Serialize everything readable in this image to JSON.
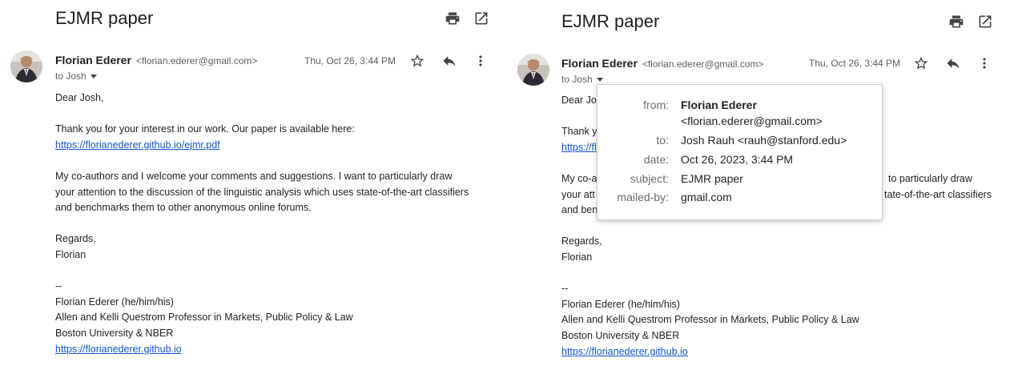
{
  "left_pane": {
    "subject": "EJMR paper",
    "sender_name": "Florian Ederer",
    "sender_email": "<florian.ederer@gmail.com>",
    "to_line": "to Josh",
    "date": "Thu, Oct 26, 3:44 PM",
    "icons": [
      "print-icon",
      "open-in-new-window-icon",
      "star-icon",
      "reply-icon",
      "more-vert-icon"
    ],
    "body": {
      "greeting": "Dear Josh,",
      "p1": "Thank you for your interest in our work. Our paper is available here:",
      "paper_link": "https://florianederer.github.io/ejmr.pdf",
      "p2_l1": "My co-authors and I welcome your comments and suggestions. I want to particularly draw",
      "p2_l2": "your attention to the discussion of the linguistic analysis which uses state-of-the-art classifiers",
      "p2_l3": "and benchmarks them to other anonymous online forums.",
      "closing": "Regards,",
      "closing_name": "Florian",
      "sig_sep": "--",
      "sig_name": "Florian Ederer (he/him/his)",
      "sig_title": "Allen and Kelli Questrom Professor in Markets, Public Policy & Law",
      "sig_org": "Boston University & NBER",
      "sig_link": "https://florianederer.github.io"
    }
  },
  "right_pane": {
    "subject": "EJMR paper",
    "sender_name": "Florian Ederer",
    "sender_email": "<florian.ederer@gmail.com>",
    "to_line": "to Josh",
    "date": "Thu, Oct 26, 3:44 PM",
    "body_visible": {
      "greeting_partial": "Dear Jo",
      "p1_partial": "Thank y",
      "link_partial": "https://fl",
      "p2_l1_left": "My co-a",
      "p2_l1_right": "to particularly draw",
      "p2_l2_left": "your att",
      "p2_l2_right": "tate-of-the-art classifiers",
      "p2_l3_left": "and ben",
      "closing": "Regards,",
      "closing_name": "Florian",
      "sig_sep": "--",
      "sig_name": "Florian Ederer (he/him/his)",
      "sig_title": "Allen and Kelli Questrom Professor in Markets, Public Policy & Law",
      "sig_org": "Boston University & NBER",
      "sig_link": "https://florianederer.github.io"
    },
    "details_popup": {
      "from_label": "from:",
      "from_name": "Florian Ederer",
      "from_email": "<florian.ederer@gmail.com>",
      "to_label": "to:",
      "to_value": "Josh Rauh <rauh@stanford.edu>",
      "date_label": "date:",
      "date_value": "Oct 26, 2023, 3:44 PM",
      "subject_label": "subject:",
      "subject_value": "EJMR paper",
      "mailed_by_label": "mailed-by:",
      "mailed_by_value": "gmail.com"
    }
  },
  "colors": {
    "link": "#1155cc",
    "text": "#222222",
    "muted": "#5e5e5e",
    "popup_label": "#6b6b6b"
  }
}
